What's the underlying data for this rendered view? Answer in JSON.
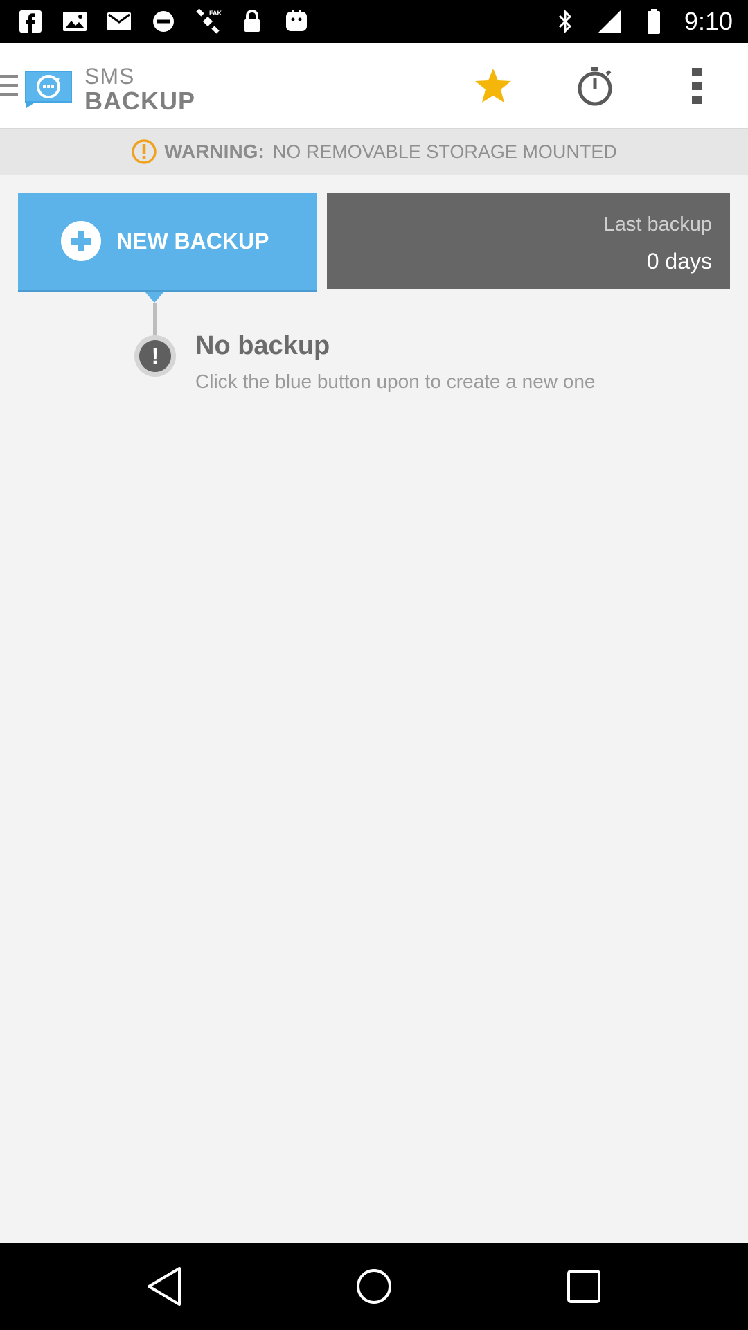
{
  "status_bar": {
    "time": "9:10",
    "left_icons": [
      "facebook-icon",
      "image-icon",
      "mail-icon",
      "do-not-disturb-icon",
      "satellite-icon",
      "lock-icon",
      "android-icon"
    ],
    "right_icons": [
      "bluetooth-icon",
      "signal-icon",
      "battery-icon"
    ]
  },
  "app_bar": {
    "app_name_line1": "SMS",
    "app_name_line2": "BACKUP",
    "actions": [
      "star-icon",
      "timer-icon",
      "overflow-menu-icon"
    ],
    "star_color": "#f5b60a"
  },
  "warning": {
    "label": "WARNING:",
    "message": "NO REMOVABLE STORAGE MOUNTED",
    "icon_color": "#f0a21f"
  },
  "main": {
    "new_backup_label": "NEW BACKUP",
    "last_backup_title": "Last backup",
    "last_backup_value": "0 days",
    "empty_title": "No backup",
    "empty_subtitle": "Click the blue button upon to create a new one",
    "accent_color": "#5bb3ea"
  },
  "nav_bar": {
    "buttons": [
      "back-icon",
      "home-icon",
      "recents-icon"
    ]
  }
}
